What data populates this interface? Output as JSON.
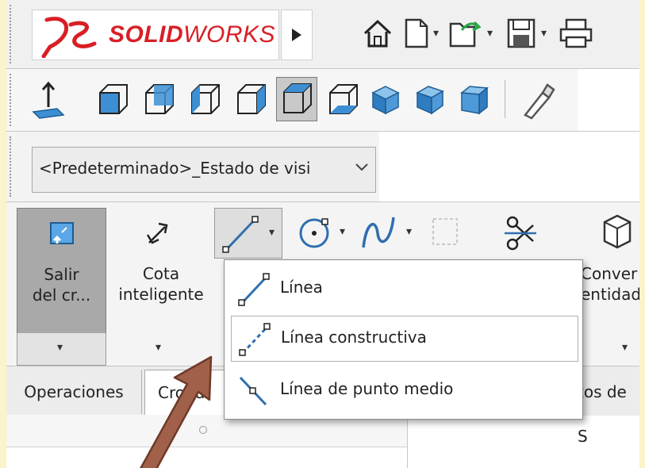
{
  "app": {
    "brand_prefix": "SOLID",
    "brand_suffix": "WORKS",
    "icons": [
      "ds-logo-icon",
      "expand-arrow-icon",
      "home-icon",
      "new-document-icon",
      "open-document-icon",
      "save-icon",
      "print-icon"
    ]
  },
  "view_toolbar": {
    "icons": [
      "normal-to-icon",
      "view-orientation-icons",
      "isometric-shaded-icons",
      "flashlight-icon"
    ]
  },
  "display_state": {
    "value": "<Predeterminado>_Estado de visi"
  },
  "command_manager": {
    "exit_sketch": {
      "line1": "Salir",
      "line2": "del cr..."
    },
    "smart_dimension": {
      "line1": "Cota",
      "line2": "inteligente"
    },
    "convert_entities": {
      "line1": "Conver",
      "line2": "entidad"
    }
  },
  "line_menu": {
    "items": [
      {
        "label": "Línea",
        "icon": "line-icon"
      },
      {
        "label": "Línea constructiva",
        "icon": "construction-line-icon"
      },
      {
        "label": "Línea de punto medio",
        "icon": "midpoint-line-icon"
      }
    ]
  },
  "tabs": {
    "operaciones": "Operaciones",
    "croquis_partial": "Croqui",
    "right_partial": "tos de S"
  },
  "colors": {
    "background": "#fbf3c9",
    "brand_red": "#d81f26",
    "icon_blue": "#2f6fb0",
    "arrow_brown": "#a0604a"
  }
}
